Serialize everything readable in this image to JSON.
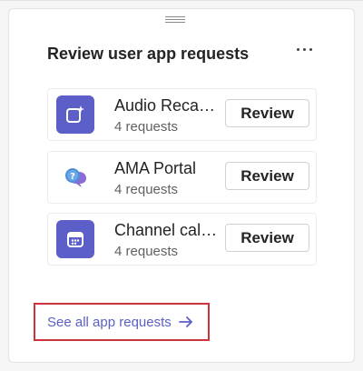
{
  "card": {
    "title": "Review user app requests"
  },
  "apps": [
    {
      "name": "Audio Recap",
      "display_name": "Audio Reca…",
      "requests": "4 requests",
      "review_label": "Review",
      "icon": "sparkle-app-icon"
    },
    {
      "name": "AMA Portal",
      "display_name": "AMA Portal",
      "requests": "4 requests",
      "review_label": "Review",
      "icon": "chat-question-icon"
    },
    {
      "name": "Channel calendar",
      "display_name": "Channel cal…",
      "requests": "4 requests",
      "review_label": "Review",
      "icon": "calendar-icon"
    }
  ],
  "footer": {
    "see_all_label": "See all app requests",
    "arrow_icon": "arrow-right-icon"
  },
  "colors": {
    "brand": "#5b5fc7",
    "highlight_border": "#d13438"
  }
}
